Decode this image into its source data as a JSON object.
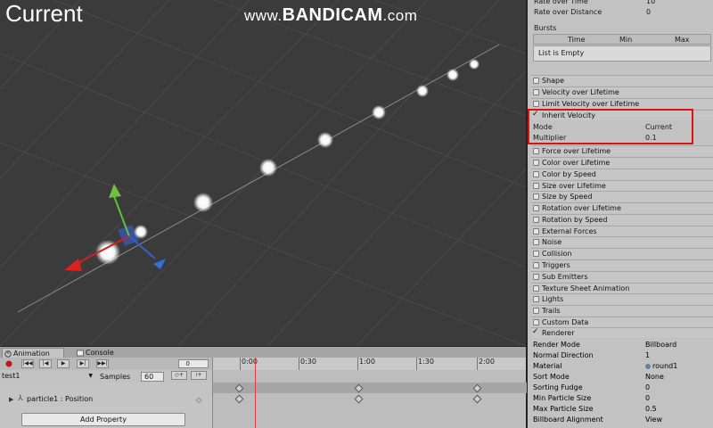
{
  "scene": {
    "title": "Current",
    "watermark_prefix": "www.",
    "watermark_brand": "BANDICAM",
    "watermark_suffix": ".com"
  },
  "inspector": {
    "top_rows": [
      {
        "label": "Rate over Time",
        "value": "10"
      },
      {
        "label": "Rate over Distance",
        "value": "0"
      }
    ],
    "bursts_label": "Bursts",
    "bursts_columns": [
      "Time",
      "Min",
      "Max"
    ],
    "bursts_empty": "List is Empty",
    "modules": [
      {
        "label": "Shape",
        "checked": false
      },
      {
        "label": "Velocity over Lifetime",
        "checked": false
      },
      {
        "label": "Limit Velocity over Lifetime",
        "checked": false
      },
      {
        "label": "Inherit Velocity",
        "checked": true
      },
      {
        "label": "Force over Lifetime",
        "checked": false
      },
      {
        "label": "Color over Lifetime",
        "checked": false
      },
      {
        "label": "Color by Speed",
        "checked": false
      },
      {
        "label": "Size over Lifetime",
        "checked": false
      },
      {
        "label": "Size by Speed",
        "checked": false
      },
      {
        "label": "Rotation over Lifetime",
        "checked": false
      },
      {
        "label": "Rotation by Speed",
        "checked": false
      },
      {
        "label": "External Forces",
        "checked": false
      },
      {
        "label": "Noise",
        "checked": false
      },
      {
        "label": "Collision",
        "checked": false
      },
      {
        "label": "Triggers",
        "checked": false
      },
      {
        "label": "Sub Emitters",
        "checked": false
      },
      {
        "label": "Texture Sheet Animation",
        "checked": false
      },
      {
        "label": "Lights",
        "checked": false
      },
      {
        "label": "Trails",
        "checked": false
      },
      {
        "label": "Custom Data",
        "checked": false
      },
      {
        "label": "Renderer",
        "checked": true
      }
    ],
    "inherit_velocity": {
      "mode_label": "Mode",
      "mode_value": "Current",
      "multiplier_label": "Multiplier",
      "multiplier_value": "0.1"
    },
    "renderer_rows": [
      {
        "label": "Render Mode",
        "value": "Billboard"
      },
      {
        "label": "Normal Direction",
        "value": "1"
      },
      {
        "label": "Material",
        "value": "round1"
      },
      {
        "label": "Sort Mode",
        "value": "None"
      },
      {
        "label": "Sorting Fudge",
        "value": "0"
      },
      {
        "label": "Min Particle Size",
        "value": "0"
      },
      {
        "label": "Max Particle Size",
        "value": "0.5"
      },
      {
        "label": "Billboard Alignment",
        "value": "View"
      }
    ]
  },
  "animation": {
    "tabs": [
      "Animation",
      "Console"
    ],
    "frame_value": "0",
    "ruler_ticks": [
      "0:00",
      "0:30",
      "1:00",
      "1:30",
      "2:00"
    ],
    "clip_name": "test1",
    "samples_label": "Samples",
    "samples_value": "60",
    "property_name": "particle1 : Position",
    "add_property_label": "Add Property"
  }
}
